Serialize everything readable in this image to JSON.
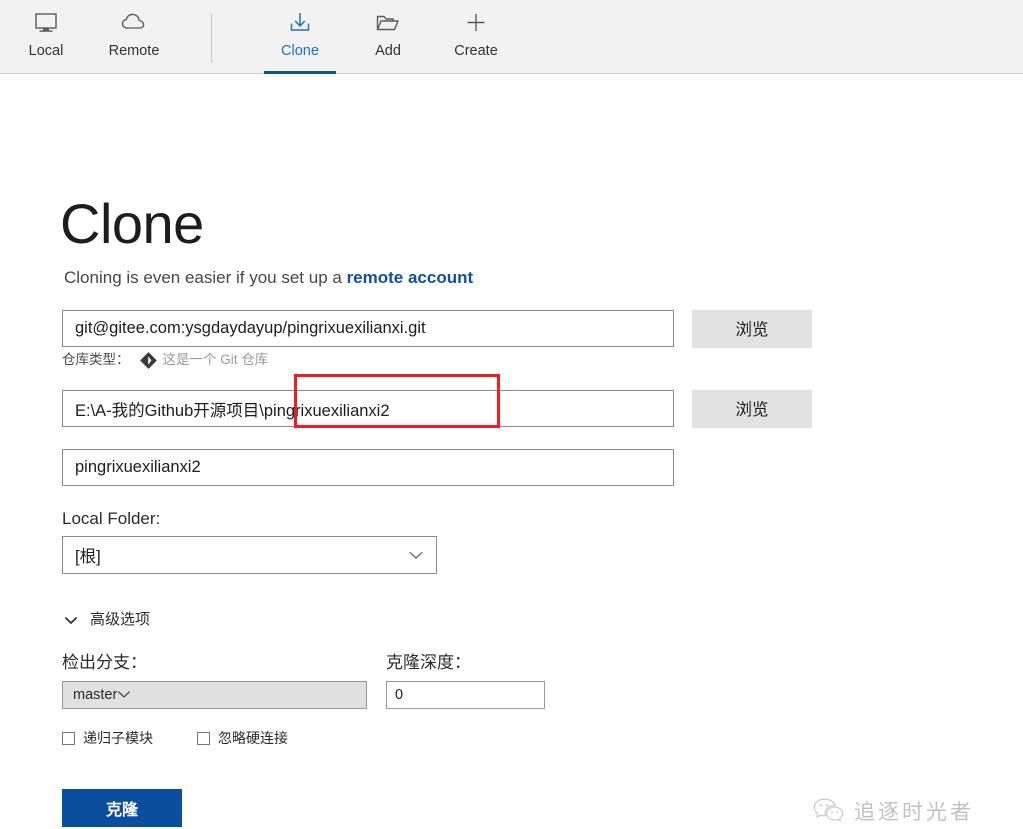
{
  "toolbar": {
    "items": [
      {
        "label": "Local",
        "icon": "monitor-icon",
        "active": false
      },
      {
        "label": "Remote",
        "icon": "cloud-icon",
        "active": false
      },
      {
        "label": "Clone",
        "icon": "download-icon",
        "active": true
      },
      {
        "label": "Add",
        "icon": "folder-icon",
        "active": false
      },
      {
        "label": "Create",
        "icon": "plus-icon",
        "active": false
      }
    ]
  },
  "page": {
    "title": "Clone",
    "subtitle_prefix": "Cloning is even easier if you set up a ",
    "subtitle_link": "remote account"
  },
  "form": {
    "url_value": "git@gitee.com:ysgdaydayup/pingrixuexilianxi.git",
    "browse_label_1": "浏览",
    "repo_type_label": "仓库类型：",
    "repo_type_value": "这是一个 Git 仓库",
    "path_value": "E:\\A-我的Github开源项目\\pingrixuexilianxi2",
    "browse_label_2": "浏览",
    "name_value": "pingrixuexilianxi2",
    "local_folder_label": "Local Folder:",
    "local_folder_value": "[根]"
  },
  "advanced": {
    "toggle_label": "高级选项",
    "branch_label": "检出分支：",
    "branch_value": "master",
    "depth_label": "克隆深度：",
    "depth_value": "0",
    "checkbox_submodule": "递归子模块",
    "checkbox_hardlink": "忽略硬连接"
  },
  "actions": {
    "clone_label": "克隆"
  },
  "watermark": {
    "text": "追逐时光者"
  },
  "colors": {
    "accent_blue": "#0a4f9e",
    "link_blue": "#12509e",
    "tab_active": "#1b72c2",
    "annotation_red": "#ef1d1d",
    "toolbar_bg": "#f2f2f2",
    "button_gray": "#e2e2e2"
  }
}
